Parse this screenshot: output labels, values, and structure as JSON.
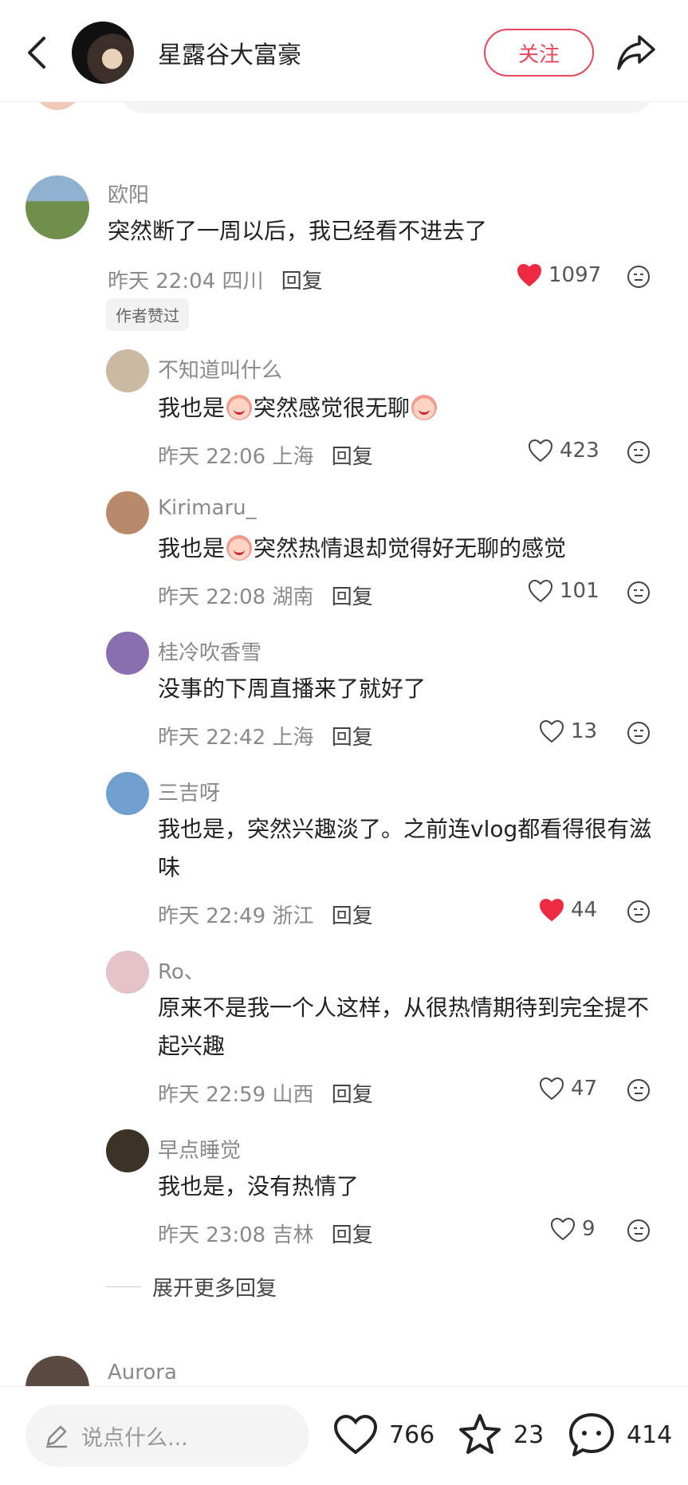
{
  "header": {
    "author_name": "星露谷大富豪",
    "follow_label": "关注"
  },
  "comment": {
    "name": "欧阳",
    "text": "突然断了一周以后，我已经看不进去了",
    "time": "昨天 22:04",
    "location": "四川",
    "reply_label": "回复",
    "likes": "1097",
    "liked": true,
    "author_tag": "作者赞过"
  },
  "replies": [
    {
      "name": "不知道叫什么",
      "text_a": "我也是",
      "text_b": "突然感觉很无聊",
      "time": "昨天 22:06",
      "location": "上海",
      "reply_label": "回复",
      "likes": "423",
      "liked": false,
      "avatar_color": "#cbb9a2"
    },
    {
      "name": "Kirimaru_",
      "text_a": "我也是",
      "text_b": "突然热情退却觉得好无聊的感觉",
      "time": "昨天 22:08",
      "location": "湖南",
      "reply_label": "回复",
      "likes": "101",
      "liked": false,
      "avatar_color": "#b88a6a"
    },
    {
      "name": "桂冷吹香雪",
      "text": "没事的下周直播来了就好了",
      "time": "昨天 22:42",
      "location": "上海",
      "reply_label": "回复",
      "likes": "13",
      "liked": false,
      "avatar_color": "#8a6fb0"
    },
    {
      "name": "三吉呀",
      "text": "我也是，突然兴趣淡了。之前连vlog都看得很有滋味",
      "time": "昨天 22:49",
      "location": "浙江",
      "reply_label": "回复",
      "likes": "44",
      "liked": true,
      "avatar_color": "#6f9fcf"
    },
    {
      "name": "Ro、",
      "text": "原来不是我一个人这样，从很热情期待到完全提不起兴趣",
      "time": "昨天 22:59",
      "location": "山西",
      "reply_label": "回复",
      "likes": "47",
      "liked": false,
      "avatar_color": "#e4c3c8"
    },
    {
      "name": "早点睡觉",
      "text": "我也是，没有热情了",
      "time": "昨天 23:08",
      "location": "吉林",
      "reply_label": "回复",
      "likes": "9",
      "liked": false,
      "avatar_color": "#3a3326"
    }
  ],
  "expand_label": "展开更多回复",
  "next_comment_name": "Aurora",
  "bottom": {
    "input_placeholder": "说点什么...",
    "likes": "766",
    "stars": "23",
    "comments": "414"
  },
  "colors": {
    "accent": "#e9475a",
    "like_red": "#ee2a43"
  },
  "icons": [
    "back-arrow-icon",
    "share-icon",
    "heart-icon",
    "more-face-icon",
    "pencil-icon",
    "star-icon",
    "comment-bubble-icon"
  ]
}
